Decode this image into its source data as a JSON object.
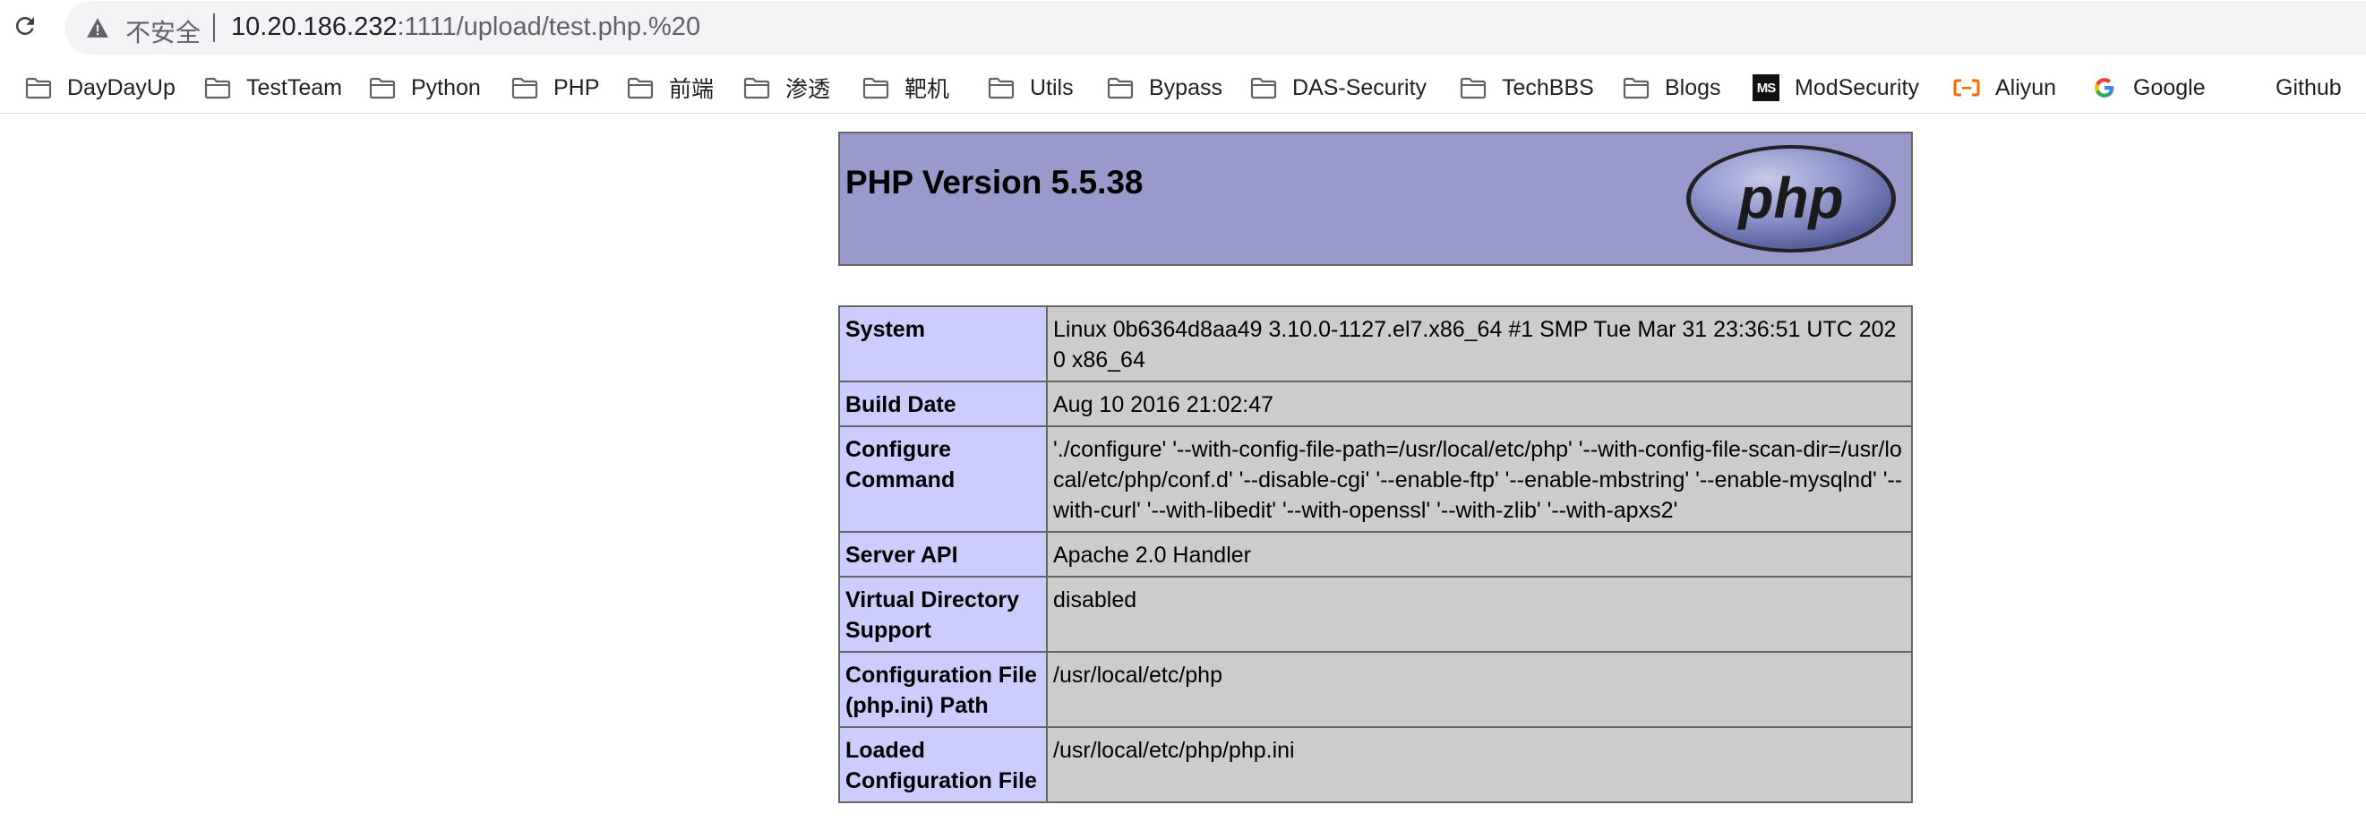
{
  "browser": {
    "security_label": "不安全",
    "url_host": "10.20.186.232",
    "url_rest": ":1111/upload/test.php.%20",
    "bookmarks": [
      {
        "label": "DayDayUp",
        "icon": "folder-icon"
      },
      {
        "label": "TestTeam",
        "icon": "folder-icon"
      },
      {
        "label": "Python",
        "icon": "folder-icon"
      },
      {
        "label": "PHP",
        "icon": "folder-icon"
      },
      {
        "label": "前端",
        "icon": "folder-icon"
      },
      {
        "label": "渗透",
        "icon": "folder-icon"
      },
      {
        "label": "靶机",
        "icon": "folder-icon"
      },
      {
        "label": "Utils",
        "icon": "folder-icon"
      },
      {
        "label": "Bypass",
        "icon": "folder-icon"
      },
      {
        "label": "DAS-Security",
        "icon": "folder-icon"
      },
      {
        "label": "TechBBS",
        "icon": "folder-icon"
      },
      {
        "label": "Blogs",
        "icon": "folder-icon"
      },
      {
        "label": "ModSecurity",
        "icon": "modsecurity-icon"
      },
      {
        "label": "Aliyun",
        "icon": "aliyun-icon"
      },
      {
        "label": "Google",
        "icon": "google-icon"
      },
      {
        "label": "Github",
        "icon": "github-icon"
      }
    ]
  },
  "phpinfo": {
    "title": "PHP Version 5.5.38",
    "logo_text": "php",
    "rows": [
      {
        "key": "System",
        "value": "Linux 0b6364d8aa49 3.10.0-1127.el7.x86_64 #1 SMP Tue Mar 31 23:36:51 UTC 2020 x86_64"
      },
      {
        "key": "Build Date",
        "value": "Aug 10 2016 21:02:47"
      },
      {
        "key": "Configure Command",
        "value": "'./configure' '--with-config-file-path=/usr/local/etc/php' '--with-config-file-scan-dir=/usr/local/etc/php/conf.d' '--disable-cgi' '--enable-ftp' '--enable-mbstring' '--enable-mysqlnd' '--with-curl' '--with-libedit' '--with-openssl' '--with-zlib' '--with-apxs2'"
      },
      {
        "key": "Server API",
        "value": "Apache 2.0 Handler"
      },
      {
        "key": "Virtual Directory Support",
        "value": "disabled"
      },
      {
        "key": "Configuration File (php.ini) Path",
        "value": "/usr/local/etc/php"
      },
      {
        "key": "Loaded Configuration File",
        "value": "/usr/local/etc/php/php.ini"
      }
    ]
  },
  "colors": {
    "header_bg": "#9999cc",
    "key_bg": "#ccccff",
    "value_bg": "#cccccc"
  }
}
